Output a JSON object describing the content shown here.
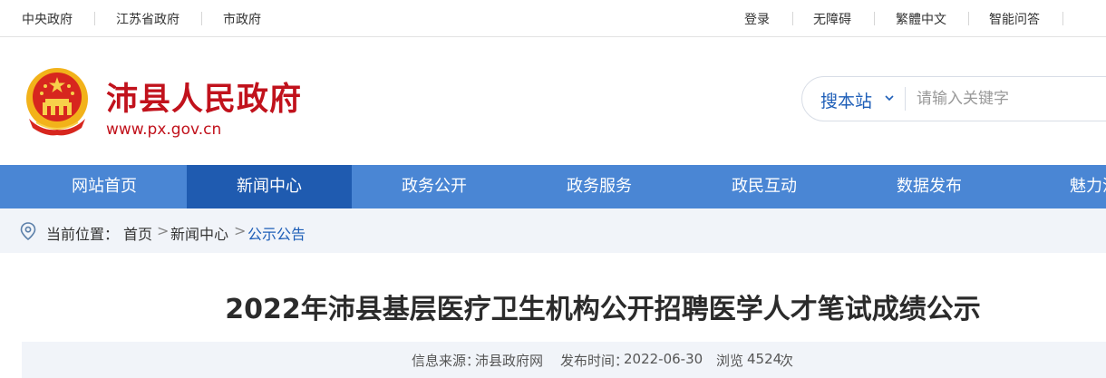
{
  "topbar": {
    "left_links": [
      "中央政府",
      "江苏省政府",
      "市政府"
    ],
    "right_links": [
      "登录",
      "无障碍",
      "繁體中文",
      "智能问答"
    ]
  },
  "header": {
    "title": "沛县人民政府",
    "url": "www.px.gov.cn",
    "emblem_icon": "national-emblem-icon",
    "brand_color": "#c1121c"
  },
  "search": {
    "scope_label": "搜本站",
    "placeholder": "请输入关键字",
    "value": ""
  },
  "nav": {
    "items": [
      "网站首页",
      "新闻中心",
      "政务公开",
      "政务服务",
      "政民互动",
      "数据发布",
      "魅力沛"
    ],
    "active": "新闻中心",
    "color": "#4a86d4",
    "active_color": "#1f5bb0"
  },
  "breadcrumb": {
    "prefix": "当前位置：",
    "items": [
      "首页",
      "新闻中心",
      "公示公告"
    ],
    "separator": ">"
  },
  "article": {
    "title": "2022年沛县基层医疗卫生机构公开招聘医学人才笔试成绩公示",
    "source_label": "信息来源：",
    "source": "沛县政府网",
    "date_label": "发布时间：",
    "date": "2022-06-30",
    "views_label": "浏览",
    "views": "4524",
    "views_unit": "次"
  }
}
